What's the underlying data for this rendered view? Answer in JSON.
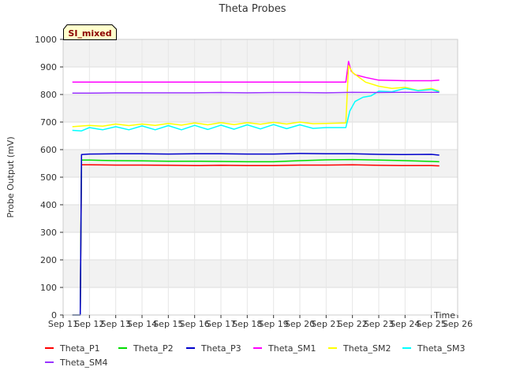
{
  "chart_data": {
    "type": "line",
    "title": "Theta Probes",
    "xlabel": "Time",
    "ylabel": "Probe Output (mV)",
    "tag": "SI_mixed",
    "ylim": [
      0,
      1000
    ],
    "yticks": [
      0,
      100,
      200,
      300,
      400,
      500,
      600,
      700,
      800,
      900,
      1000
    ],
    "xlim": [
      11,
      26
    ],
    "xticks": [
      {
        "v": 11,
        "label": "Sep 11"
      },
      {
        "v": 12,
        "label": "Sep 12"
      },
      {
        "v": 13,
        "label": "Sep 13"
      },
      {
        "v": 14,
        "label": "Sep 14"
      },
      {
        "v": 15,
        "label": "Sep 15"
      },
      {
        "v": 16,
        "label": "Sep 16"
      },
      {
        "v": 17,
        "label": "Sep 17"
      },
      {
        "v": 18,
        "label": "Sep 18"
      },
      {
        "v": 19,
        "label": "Sep 19"
      },
      {
        "v": 20,
        "label": "Sep 20"
      },
      {
        "v": 21,
        "label": "Sep 21"
      },
      {
        "v": 22,
        "label": "Sep 22"
      },
      {
        "v": 23,
        "label": "Sep 23"
      },
      {
        "v": 24,
        "label": "Sep 24"
      },
      {
        "v": 25,
        "label": "Sep 25"
      },
      {
        "v": 26,
        "label": "Sep 26"
      }
    ],
    "grid": true,
    "legend_position": "bottom",
    "series": [
      {
        "name": "Theta_P1",
        "color": "#ff0000",
        "x": [
          11.35,
          11.65,
          11.7,
          12.0,
          13.0,
          14.0,
          15.0,
          16.0,
          17.0,
          18.0,
          19.0,
          20.0,
          21.0,
          22.0,
          23.0,
          24.0,
          25.0,
          25.3
        ],
        "y": [
          0,
          0,
          545,
          545,
          544,
          544,
          543,
          542,
          543,
          542,
          542,
          544,
          544,
          545,
          543,
          542,
          542,
          541
        ]
      },
      {
        "name": "Theta_P2",
        "color": "#00dd00",
        "x": [
          11.35,
          11.65,
          11.7,
          12.0,
          13.0,
          14.0,
          15.0,
          16.0,
          17.0,
          18.0,
          19.0,
          20.0,
          21.0,
          22.0,
          23.0,
          24.0,
          25.0,
          25.3
        ],
        "y": [
          0,
          0,
          562,
          562,
          560,
          559,
          558,
          558,
          557,
          556,
          556,
          560,
          563,
          564,
          562,
          560,
          557,
          556
        ]
      },
      {
        "name": "Theta_P3",
        "color": "#0000cc",
        "x": [
          11.35,
          11.65,
          11.7,
          12.0,
          13.0,
          14.0,
          15.0,
          16.0,
          17.0,
          18.0,
          19.0,
          20.0,
          21.0,
          22.0,
          23.0,
          24.0,
          25.0,
          25.3
        ],
        "y": [
          0,
          0,
          582,
          584,
          585,
          585,
          584,
          585,
          585,
          584,
          584,
          586,
          585,
          585,
          583,
          582,
          583,
          580
        ]
      },
      {
        "name": "Theta_SM1",
        "color": "#ff00ff",
        "x": [
          11.35,
          12.0,
          13.0,
          14.0,
          15.0,
          16.0,
          17.0,
          18.0,
          19.0,
          20.0,
          21.0,
          21.75,
          21.85,
          21.95,
          22.1,
          22.5,
          23.0,
          24.0,
          25.0,
          25.3
        ],
        "y": [
          845,
          845,
          845,
          845,
          845,
          845,
          845,
          845,
          845,
          845,
          845,
          845,
          920,
          885,
          872,
          862,
          852,
          850,
          850,
          852
        ]
      },
      {
        "name": "Theta_SM2",
        "color": "#ffff00",
        "x": [
          11.35,
          12.0,
          12.5,
          13.0,
          13.5,
          14.0,
          14.5,
          15.0,
          15.5,
          16.0,
          16.5,
          17.0,
          17.5,
          18.0,
          18.5,
          19.0,
          19.5,
          20.0,
          20.5,
          21.0,
          21.75,
          21.85,
          22.0,
          22.5,
          23.0,
          23.5,
          24.0,
          24.5,
          25.0,
          25.3
        ],
        "y": [
          683,
          688,
          685,
          693,
          687,
          693,
          688,
          695,
          689,
          697,
          690,
          698,
          691,
          698,
          692,
          699,
          693,
          700,
          694,
          695,
          697,
          905,
          880,
          845,
          830,
          822,
          826,
          815,
          822,
          812
        ]
      },
      {
        "name": "Theta_SM3",
        "color": "#00ffff",
        "x": [
          11.35,
          11.7,
          12.0,
          12.5,
          13.0,
          13.5,
          14.0,
          14.5,
          15.0,
          15.5,
          16.0,
          16.5,
          17.0,
          17.5,
          18.0,
          18.5,
          19.0,
          19.5,
          20.0,
          20.5,
          21.0,
          21.75,
          21.9,
          22.1,
          22.4,
          22.7,
          23.0,
          23.5,
          24.0,
          24.5,
          25.0,
          25.3
        ],
        "y": [
          670,
          668,
          680,
          672,
          683,
          672,
          686,
          672,
          687,
          672,
          688,
          673,
          689,
          674,
          690,
          675,
          691,
          676,
          690,
          677,
          680,
          680,
          740,
          775,
          790,
          795,
          812,
          810,
          822,
          814,
          818,
          810
        ]
      },
      {
        "name": "Theta_SM4",
        "color": "#9933ff",
        "x": [
          11.35,
          12.0,
          13.0,
          14.0,
          15.0,
          16.0,
          17.0,
          18.0,
          19.0,
          20.0,
          21.0,
          22.0,
          23.0,
          24.0,
          25.0,
          25.3
        ],
        "y": [
          805,
          805,
          806,
          806,
          806,
          806,
          807,
          806,
          807,
          807,
          806,
          808,
          807,
          808,
          808,
          808
        ]
      }
    ]
  }
}
